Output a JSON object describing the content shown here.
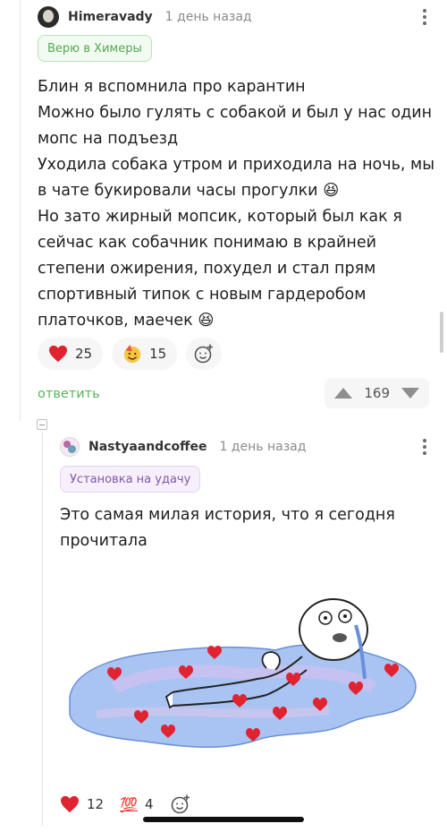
{
  "comment": {
    "author": "Himeravady",
    "time": "1 день назад",
    "badge": "Верю в Химеры",
    "lines": [
      "Блин я вспомнила про карантин",
      "Можно было гулять с собакой и был у нас один",
      "мопс на подъезд",
      "Уходила собака утром и приходила на ночь, мы",
      "в чате букировали часы прогулки 😆",
      "Но зато жирный мопсик, который был как я",
      "сейчас как собачник понимаю в крайней",
      "степени ожирения, похудел и стал прям",
      "спортивный типок с новым гардеробом",
      "платочков, маечек 😆"
    ],
    "reactions": [
      {
        "icon": "heart-icon",
        "count": "25"
      },
      {
        "icon": "party-face-icon",
        "count": "15"
      }
    ],
    "reply_label": "ответить",
    "rating": "169"
  },
  "reply": {
    "author": "Nastyaandcoffee",
    "time": "1 день назад",
    "badge": "Установка на удачу",
    "lines": [
      "Это самая милая история, что я сегодня",
      "прочитала"
    ],
    "reactions": [
      {
        "icon": "heart-icon",
        "count": "12"
      },
      {
        "icon": "hundred-points-icon",
        "count": "4"
      }
    ],
    "hundred_glyph": "💯"
  },
  "colors": {
    "accent_green": "#57b657",
    "heart_red": "#e02330",
    "badge_purple": "#7f58a6"
  }
}
